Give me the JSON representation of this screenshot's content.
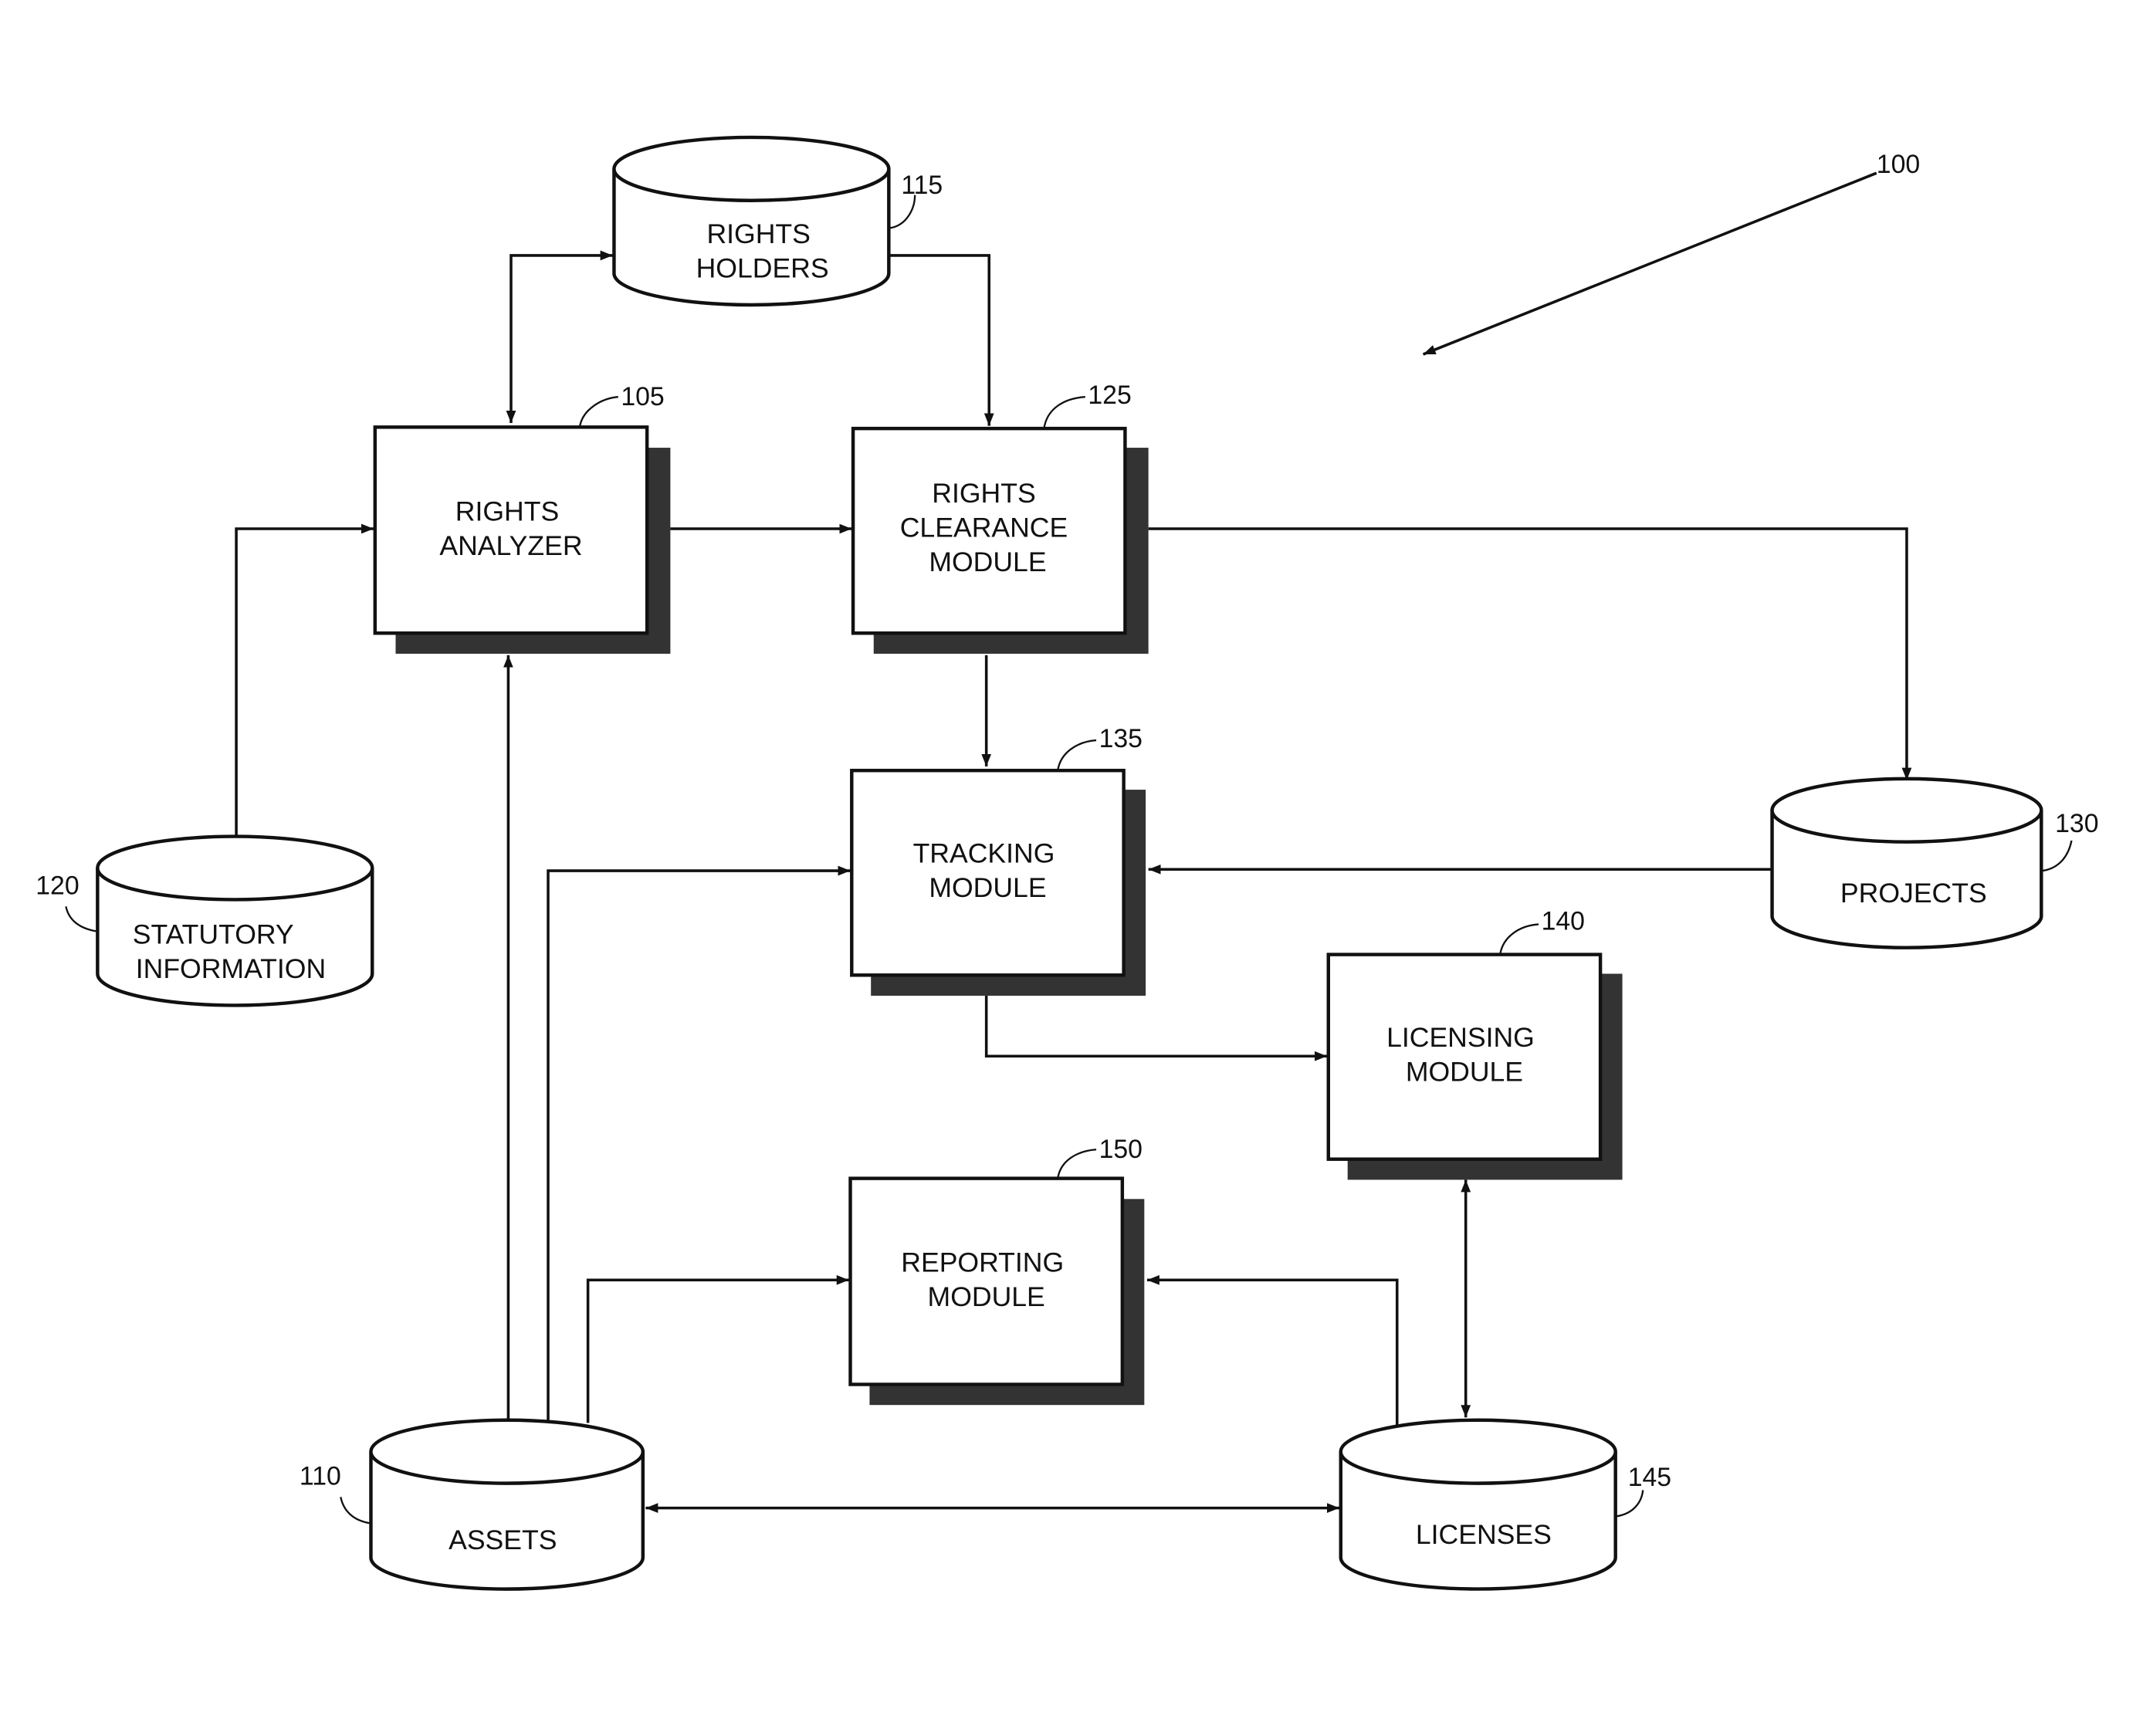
{
  "figure": {
    "ref": "100",
    "modules": [
      {
        "id": "rights_analyzer",
        "ref": "105",
        "lines": [
          "RIGHTS",
          "ANALYZER"
        ]
      },
      {
        "id": "rights_clearance",
        "ref": "125",
        "lines": [
          "RIGHTS",
          "CLEARANCE",
          "MODULE"
        ]
      },
      {
        "id": "tracking",
        "ref": "135",
        "lines": [
          "TRACKING",
          "MODULE"
        ]
      },
      {
        "id": "licensing",
        "ref": "140",
        "lines": [
          "LICENSING",
          "MODULE"
        ]
      },
      {
        "id": "reporting",
        "ref": "150",
        "lines": [
          "REPORTING",
          "MODULE"
        ]
      }
    ],
    "databases": [
      {
        "id": "rights_holders",
        "ref": "115",
        "lines": [
          "RIGHTS",
          "HOLDERS"
        ]
      },
      {
        "id": "statutory",
        "ref": "120",
        "lines": [
          "STATUTORY",
          "INFORMATION"
        ]
      },
      {
        "id": "projects",
        "ref": "130",
        "lines": [
          "PROJECTS"
        ]
      },
      {
        "id": "assets",
        "ref": "110",
        "lines": [
          "ASSETS"
        ]
      },
      {
        "id": "licenses",
        "ref": "145",
        "lines": [
          "LICENSES"
        ]
      }
    ],
    "connections": [
      {
        "from": "rights_analyzer",
        "to": "rights_holders",
        "direction": "bidirectional"
      },
      {
        "from": "rights_holders",
        "to": "rights_clearance",
        "direction": "forward"
      },
      {
        "from": "statutory",
        "to": "rights_analyzer",
        "direction": "forward"
      },
      {
        "from": "rights_analyzer",
        "to": "rights_clearance",
        "direction": "forward"
      },
      {
        "from": "rights_clearance",
        "to": "projects",
        "direction": "forward"
      },
      {
        "from": "rights_clearance",
        "to": "tracking",
        "direction": "forward"
      },
      {
        "from": "projects",
        "to": "tracking",
        "direction": "forward"
      },
      {
        "from": "assets",
        "to": "rights_analyzer",
        "direction": "forward"
      },
      {
        "from": "assets",
        "to": "tracking",
        "direction": "forward"
      },
      {
        "from": "assets",
        "to": "reporting",
        "direction": "forward"
      },
      {
        "from": "tracking",
        "to": "licensing",
        "direction": "forward"
      },
      {
        "from": "licensing",
        "to": "licenses",
        "direction": "bidirectional"
      },
      {
        "from": "licenses",
        "to": "reporting",
        "direction": "forward"
      },
      {
        "from": "assets",
        "to": "licenses",
        "direction": "bidirectional"
      }
    ]
  }
}
